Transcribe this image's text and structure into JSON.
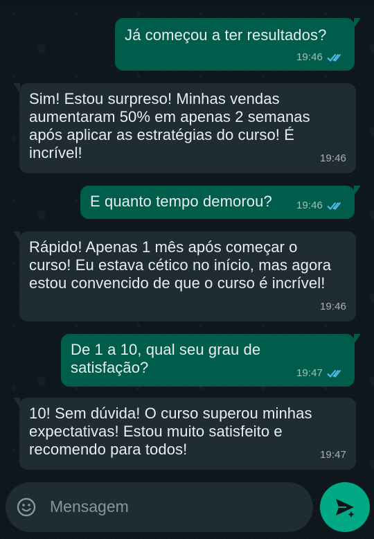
{
  "messages": [
    {
      "dir": "out",
      "text": "Já começou a ter resultados?",
      "time": "19:46",
      "status": "read"
    },
    {
      "dir": "in",
      "text": "Sim! Estou surpreso! Minhas vendas aumentaram 50% em apenas 2 semanas após aplicar as estratégias do curso! É incrível!",
      "time": "19:46"
    },
    {
      "dir": "out",
      "text": "E quanto tempo demorou?",
      "time": "19:46",
      "status": "read"
    },
    {
      "dir": "in",
      "text": "Rápido! Apenas 1 mês após começar o curso! Eu estava cético no início, mas agora estou convencido de que o curso é incrível!",
      "time": "19:46"
    },
    {
      "dir": "out",
      "text": "De 1 a 10, qual seu grau de satisfação?",
      "time": "19:47",
      "status": "read"
    },
    {
      "dir": "in",
      "text": "10! Sem dúvida! O curso superou minhas expectativas! Estou muito satisfeito e recomendo para todos!",
      "time": "19:47"
    }
  ],
  "composer": {
    "placeholder": "Mensagem"
  },
  "icons": {
    "emoji": "emoji-icon",
    "send": "send-icon",
    "read_ticks": "double-check-icon"
  },
  "colors": {
    "outgoing": "#005c4b",
    "incoming": "#202c33",
    "accent": "#00a884",
    "tick_read": "#53bdeb"
  }
}
